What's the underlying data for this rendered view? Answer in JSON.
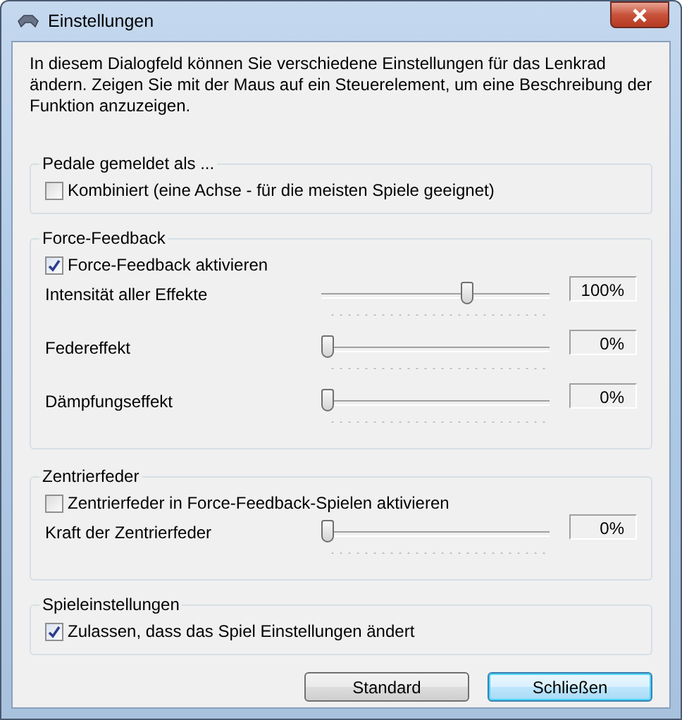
{
  "window": {
    "title": "Einstellungen"
  },
  "intro": "In diesem Dialogfeld können Sie verschiedene Einstellungen für das Lenkrad ändern.  Zeigen Sie mit der Maus auf ein Steuerelement, um eine Beschreibung der Funktion anzuzeigen.",
  "groups": [
    {
      "title": "Pedale gemeldet als ...",
      "items": [
        {
          "kind": "checkbox",
          "label": "Kombiniert (eine Achse - für die meisten Spiele geeignet)",
          "checked": false
        }
      ]
    },
    {
      "title": "Force-Feedback",
      "items": [
        {
          "kind": "checkbox",
          "label": "Force-Feedback aktivieren",
          "checked": true
        },
        {
          "kind": "slider",
          "label": "Intensität aller Effekte",
          "level": 0.66,
          "reading": "100%"
        },
        {
          "kind": "slider",
          "label": "Federeffekt",
          "level": 0,
          "reading": "0%"
        },
        {
          "kind": "slider",
          "label": "Dämpfungseffekt",
          "level": 0,
          "reading": "0%"
        }
      ]
    },
    {
      "title": "Zentrierfeder",
      "items": [
        {
          "kind": "checkbox",
          "label": "Zentrierfeder in Force-Feedback-Spielen aktivieren",
          "checked": false
        },
        {
          "kind": "slider",
          "label": "Kraft der Zentrierfeder",
          "level": 0,
          "reading": "0%"
        }
      ]
    },
    {
      "title": "Spieleinstellungen",
      "items": [
        {
          "kind": "checkbox",
          "label": "Zulassen, dass das Spiel Einstellungen ändert",
          "checked": true
        }
      ]
    }
  ],
  "buttons": [
    {
      "label": "Standard",
      "selected": false
    },
    {
      "label": "Schließen",
      "selected": true
    }
  ]
}
